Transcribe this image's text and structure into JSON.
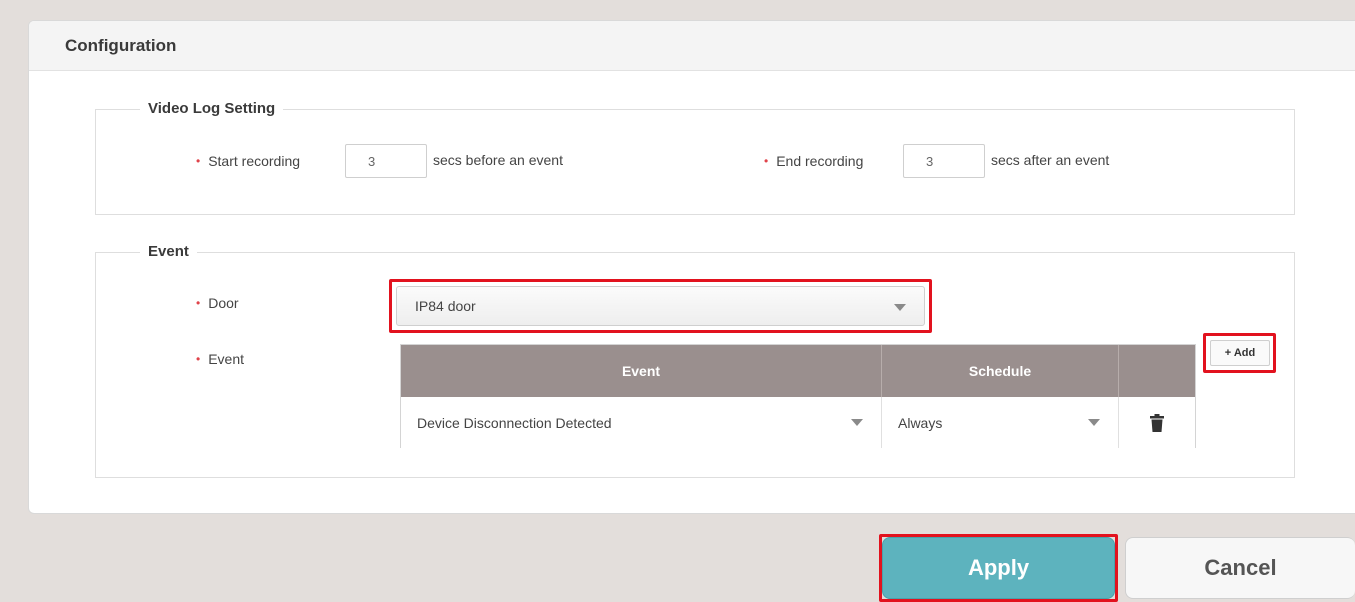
{
  "panel": {
    "title": "Configuration"
  },
  "video_log": {
    "legend": "Video Log Setting",
    "start_label": "Start recording",
    "start_value": "3",
    "start_suffix": "secs before an event",
    "end_label": "End recording",
    "end_value": "3",
    "end_suffix": "secs after an event"
  },
  "event": {
    "legend": "Event",
    "door_label": "Door",
    "door_value": "IP84 door",
    "event_label": "Event",
    "table": {
      "headers": [
        "Event",
        "Schedule",
        ""
      ],
      "rows": [
        {
          "event": "Device Disconnection Detected",
          "schedule": "Always"
        }
      ]
    },
    "add_label": "+ Add"
  },
  "actions": {
    "apply": "Apply",
    "cancel": "Cancel"
  },
  "colors": {
    "accent": "#5db3be",
    "header_bg": "#9a8f8e",
    "highlight": "#e2121e",
    "required_bullet": "#e0434a"
  },
  "icons": {
    "dropdown": "chevron-down-icon",
    "delete": "trash-icon"
  }
}
